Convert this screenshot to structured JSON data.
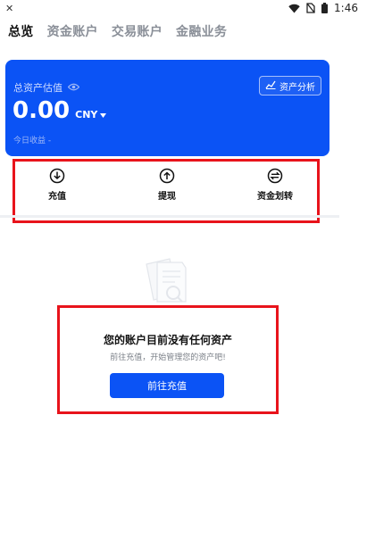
{
  "status_bar": {
    "left_glyph": "✕",
    "time": "1:46",
    "icons": [
      "wifi-icon",
      "no-sim-icon",
      "battery-icon"
    ]
  },
  "tabs": [
    {
      "label": "总览",
      "active": true
    },
    {
      "label": "资金账户",
      "active": false
    },
    {
      "label": "交易账户",
      "active": false
    },
    {
      "label": "金融业务",
      "active": false
    }
  ],
  "asset_card": {
    "label": "总资产估值",
    "value": "0.00",
    "currency": "CNY",
    "today_label": "今日收益",
    "today_value": "-",
    "analysis_label": "资产分析",
    "background": "#0b53f5"
  },
  "actions": [
    {
      "label": "充值",
      "icon": "deposit-icon"
    },
    {
      "label": "提现",
      "icon": "withdraw-icon"
    },
    {
      "label": "资金划转",
      "icon": "transfer-icon"
    }
  ],
  "empty_state": {
    "title": "您的账户目前没有任何资产",
    "subtitle": "前往充值，开始管理您的资产吧!",
    "button_label": "前往充值"
  },
  "colors": {
    "accent": "#0b53f5",
    "highlight": "#e8131b"
  }
}
